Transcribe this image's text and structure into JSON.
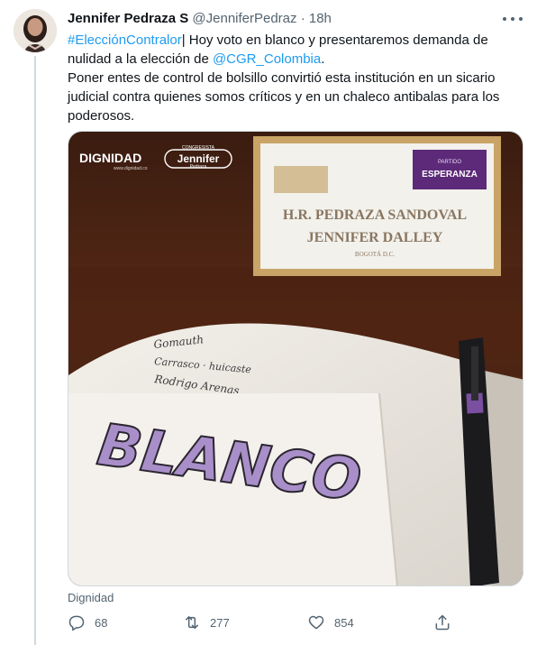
{
  "tweet": {
    "author_name": "Jennifer Pedraza S",
    "handle": "@JenniferPedraz",
    "separator": "·",
    "time": "18h",
    "text_parts": {
      "hashtag": "#ElecciónContralor",
      "part1": "| Hoy voto en blanco y presentaremos demanda de nulidad a la elección de ",
      "mention": "@CGR_Colombia",
      "part2": ".",
      "line2": "Poner entes de control de bolsillo convirtió esta institución en un sicario judicial contra quienes somos críticos y en un chaleco antibalas para los poderosos."
    },
    "media_source": "Dignidad"
  },
  "media": {
    "logo_dignidad": "DIGNIDAD",
    "logo_dignidad_sub": "www.dignidad.co",
    "logo_jennifer_top": "CONGRESISTA",
    "logo_jennifer_name": "Jennifer",
    "logo_jennifer_sub": "Pedraza",
    "sign_line1": "H.R. PEDRAZA SANDOVAL",
    "sign_line2": "JENNIFER DALLEY",
    "sign_line3": "BOGOTÁ D.C.",
    "sign_badge_top": "PARTIDO",
    "sign_badge": "ESPERANZA",
    "note_handwriting_1": "Gomauth",
    "note_handwriting_2": "Carrasco · huicaste",
    "note_handwriting_3": "Rodrigo Arenas",
    "note_big_word": "BLANCO"
  },
  "actions": {
    "reply_count": "68",
    "retweet_count": "277",
    "like_count": "854"
  },
  "colors": {
    "link": "#1d9bf0",
    "secondary": "#536471",
    "primary_text": "#0f1419",
    "note_purple": "#a98fc9"
  }
}
